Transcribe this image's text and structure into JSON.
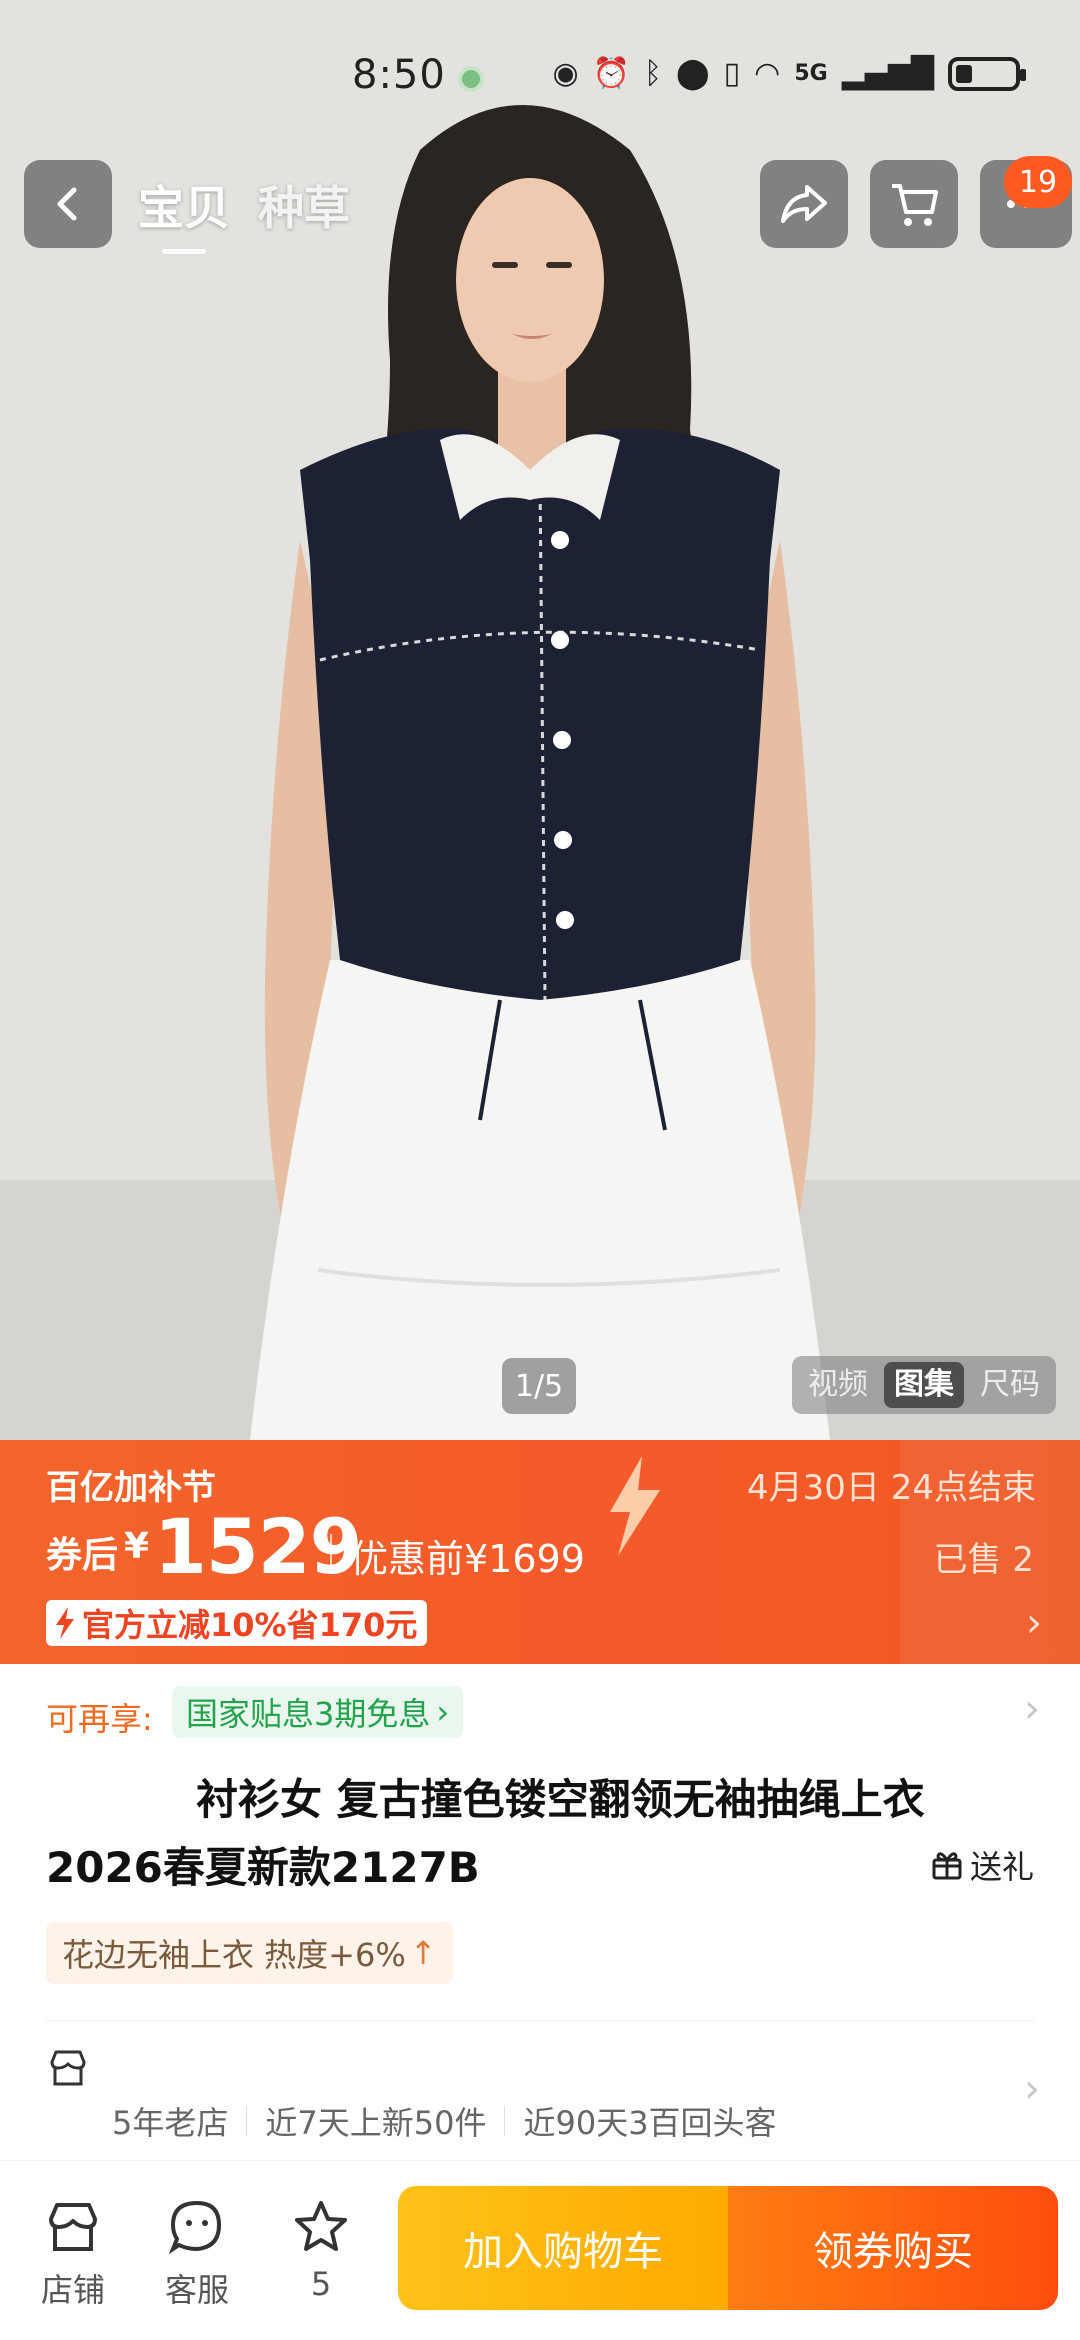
{
  "status_bar": {
    "time": "8:50",
    "network": "5G"
  },
  "nav": {
    "tabs": [
      "宝贝",
      "种草"
    ],
    "cart_badge": "19"
  },
  "gallery": {
    "counter": "1/5",
    "media_tabs": [
      "视频",
      "图集",
      "尺码"
    ],
    "active_media_tab": "图集"
  },
  "promo": {
    "festival": "百亿加补节",
    "end_date": "4月30日 24点结束",
    "after_coupon_label": "券后",
    "currency": "¥",
    "price": "1529",
    "before_price": "优惠前¥1699",
    "sold": "已售 2",
    "official_discount": "官方立减10%省170元"
  },
  "benefits": {
    "label": "可再享:",
    "chip": "国家贴息3期免息"
  },
  "product": {
    "title_line1": "衬衫女 复古撞色镂空翻领无袖抽绳上衣",
    "title_line2": "2026春夏新款2127B",
    "gift_label": "送礼",
    "heat_tag": "花边无袖上衣 热度+6%"
  },
  "store": {
    "badges": [
      "5年老店",
      "近7天上新50件",
      "近90天3百回头客"
    ]
  },
  "bottom_bar": {
    "shop_label": "店铺",
    "service_label": "客服",
    "favorite_count": "5",
    "add_to_cart": "加入购物车",
    "buy_with_coupon": "领券购买"
  },
  "colors": {
    "promo_orange": "#f3652c",
    "cart_yellow": "#ffb20f",
    "buy_orange": "#ff5a10",
    "green_chip": "#22a34c"
  }
}
